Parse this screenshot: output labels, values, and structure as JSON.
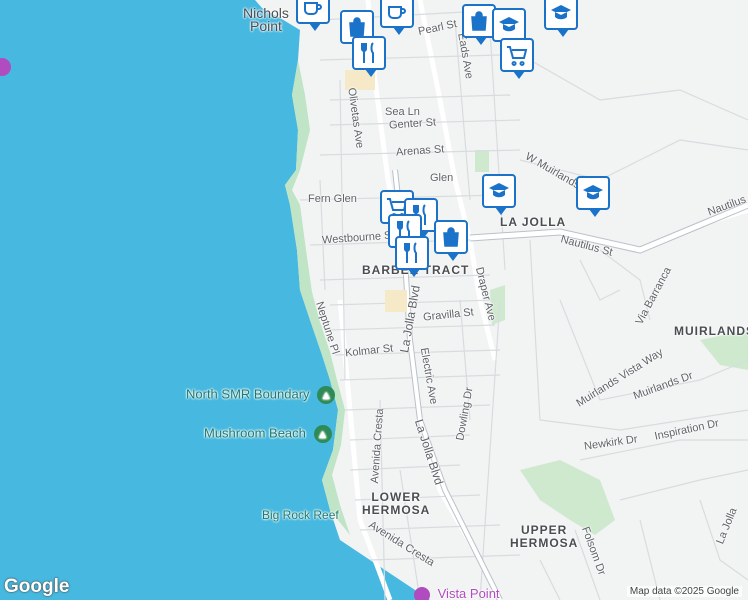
{
  "map": {
    "colors": {
      "water": "#47b9e0",
      "land": "#f2f3f3",
      "park": "#cfe9cf",
      "road": "#ffffff",
      "road_edge": "#c9ced3",
      "pin_border": "#1a73c9",
      "poi_green": "#1f7a6d"
    },
    "area_labels": {
      "nichols_point": "Nichols\nPoint",
      "la_jolla": "LA JOLLA",
      "barber_tract": "BARBER TRACT",
      "muirlands": "MUIRLANDS",
      "lower_hermosa": "LOWER\nHERMOSA",
      "upper_hermosa": "UPPER\nHERMOSA"
    },
    "streets": {
      "pearl_st": "Pearl St",
      "eads_ave": "Eads Ave",
      "olivetas_ave": "Olivetas Ave",
      "sea_ln": "Sea Ln",
      "genter_st": "Genter St",
      "arenas_st": "Arenas St",
      "fern_glen": "Fern Glen",
      "glen": "Glen",
      "westbourne_st": "Westbourne St",
      "w_muirlands": "W Muirlands",
      "nautilus_st": "Nautilus St",
      "nautilus_st_2": "Nautilus",
      "draper_ave": "Draper Ave",
      "la_jolla_blvd": "La Jolla Blvd",
      "la_jolla_blvd_2": "La Jolla Blvd",
      "gravilla_st": "Gravilla St",
      "neptune_pl": "Neptune Pl",
      "kolmar_st": "Kolmar St",
      "electric_ave": "Electric Ave",
      "dowling_dr": "Dowling Dr",
      "via_barranca": "Via Barranca",
      "muirlands_vista_way": "Muirlands Vista Way",
      "muirlands_dr": "Muirlands Dr",
      "newkirk_dr": "Newkirk Dr",
      "inspiration_dr": "Inspiration Dr",
      "avenida_cresta": "Avenida Cresta",
      "avenida_cresta_2": "Avenida Cresta",
      "folsom_dr": "Folsom Dr",
      "la_jolla_2": "La Jolla"
    },
    "pois": {
      "north_smr": "North SMR Boundary",
      "mushroom_beach": "Mushroom Beach",
      "big_rock_reef": "Big Rock Reef",
      "vista_point": "Vista Point"
    },
    "attribution": "Map data ©2025 Google",
    "logo": "Google"
  }
}
